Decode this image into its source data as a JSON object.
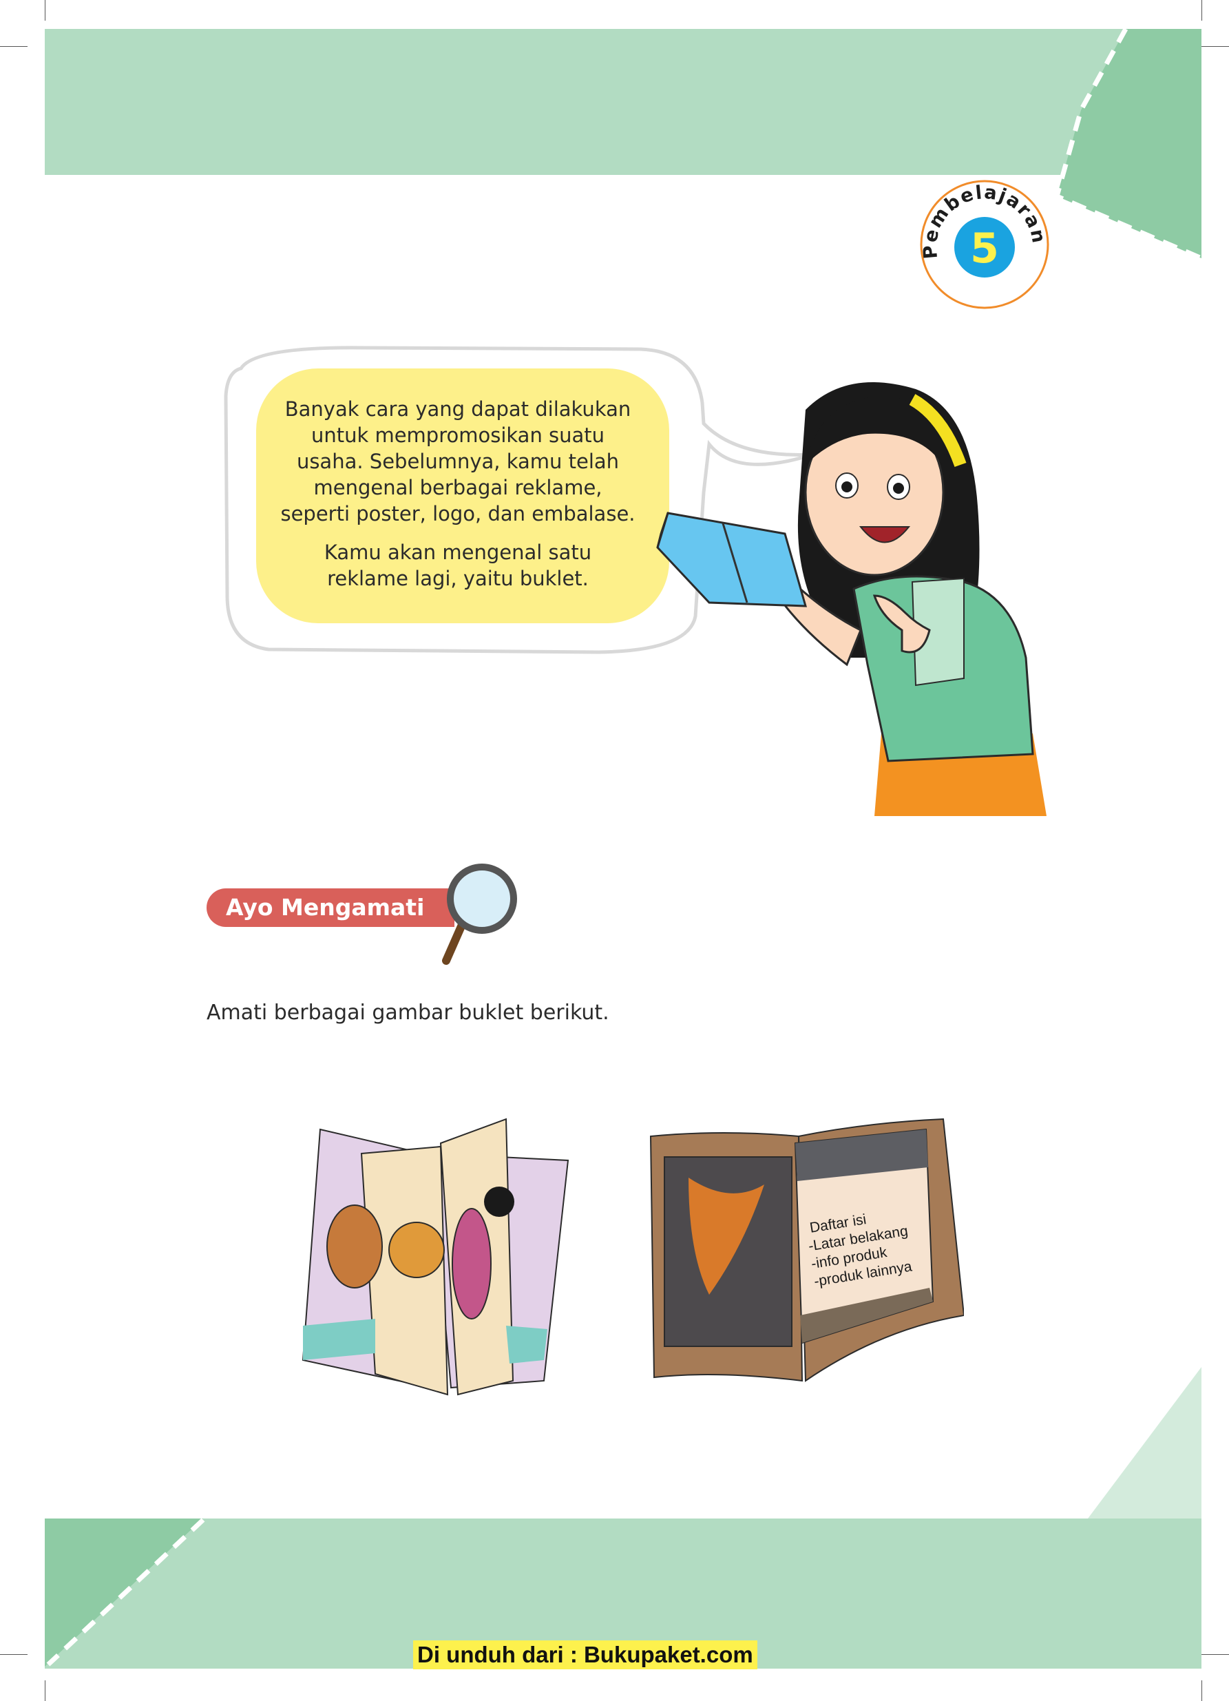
{
  "badge": {
    "word": "Pembelajaran",
    "number": "5"
  },
  "speech": {
    "paragraph1": "Banyak cara yang dapat dilakukan untuk mempromosikan suatu usaha. Sebelumnya, kamu telah mengenal berbagai reklame, seperti poster, logo, dan embalase.",
    "paragraph1_lines": [
      "Banyak cara yang dapat dilakukan",
      "untuk mempromosikan suatu",
      "usaha. Sebelumnya, kamu telah",
      "mengenal berbagai reklame,",
      "seperti poster, logo, dan embalase."
    ],
    "paragraph2_lines": [
      "Kamu akan mengenal satu",
      "reklame lagi, yaitu buklet."
    ]
  },
  "section": {
    "title": "Ayo Mengamati"
  },
  "instruction": "Amati berbagai gambar buklet berikut.",
  "booklet2": {
    "contents": [
      "Daftar isi",
      "-Latar belakang",
      "-info produk",
      "-produk lainnya"
    ]
  },
  "footer": {
    "download": "Di unduh dari : Bukupaket.com"
  },
  "colors": {
    "band": "#b2dcc2",
    "band_dark": "#8ecba4",
    "badge_blue": "#1aa3e0",
    "badge_ring": "#f18c2a",
    "bubble": "#fdf08a",
    "tag": "#d9605a"
  }
}
